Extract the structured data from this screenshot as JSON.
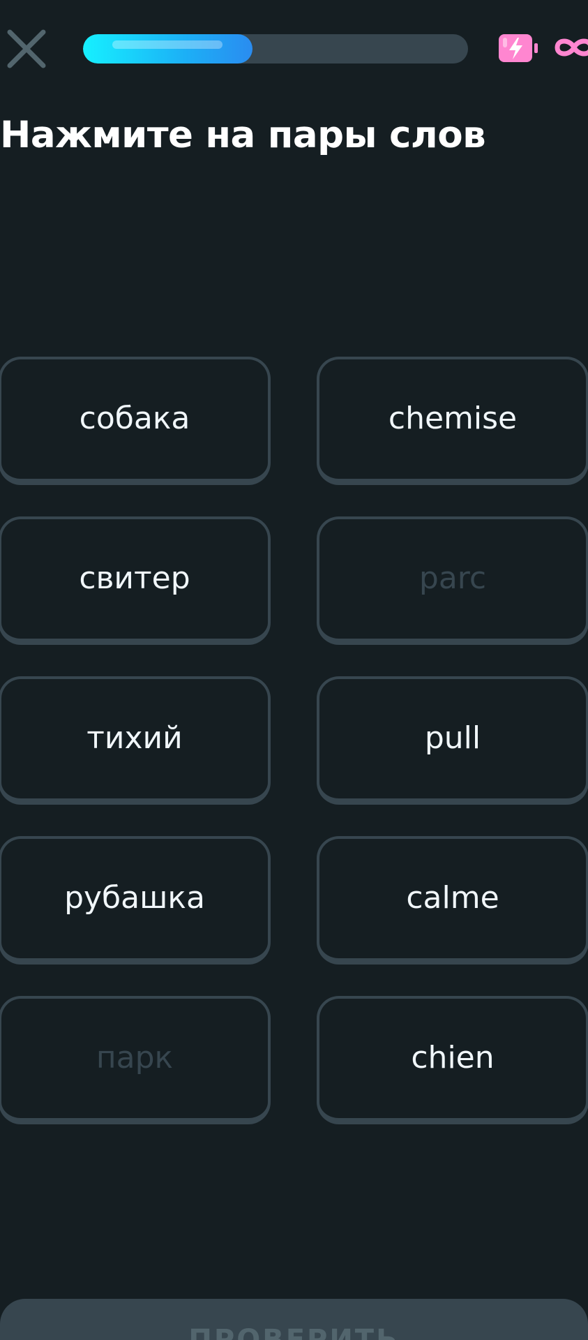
{
  "header": {
    "progress_fraction": 0.44,
    "energy_icon": "energy-battery-icon",
    "energy_color": "#ff86d0",
    "energy_value": "∞"
  },
  "prompt": {
    "title": "Нажмите на пары слов"
  },
  "tiles": {
    "left": [
      {
        "label": "собака",
        "disabled": false
      },
      {
        "label": "свитер",
        "disabled": false
      },
      {
        "label": "тихий",
        "disabled": false
      },
      {
        "label": "рубашка",
        "disabled": false
      },
      {
        "label": "парк",
        "disabled": true
      }
    ],
    "right": [
      {
        "label": "chemise",
        "disabled": false
      },
      {
        "label": "parc",
        "disabled": true
      },
      {
        "label": "pull",
        "disabled": false
      },
      {
        "label": "calme",
        "disabled": false
      },
      {
        "label": "chien",
        "disabled": false
      }
    ]
  },
  "footer": {
    "check_label": "ПРОВЕРИТЬ"
  },
  "colors": {
    "background": "#151e22",
    "tile_border": "#37464f",
    "progress_accent": "#1cb0f6",
    "disabled_text": "#37464f"
  }
}
